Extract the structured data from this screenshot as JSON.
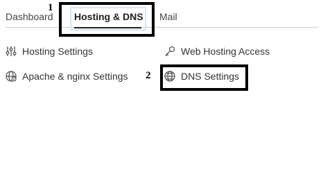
{
  "tabs": {
    "dashboard": "Dashboard",
    "hosting_dns": "Hosting & DNS",
    "mail": "Mail"
  },
  "items": {
    "hosting_settings": "Hosting Settings",
    "web_hosting_access": "Web Hosting Access",
    "apache_nginx_settings": "Apache & nginx Settings",
    "dns_settings": "DNS Settings"
  },
  "annotations": {
    "one": "1",
    "two": "2"
  },
  "icons": {
    "hosting_settings": "sliders-icon",
    "web_hosting_access": "key-icon",
    "apache_nginx_settings": "gear-globe-icon",
    "dns_settings": "globe-icon"
  },
  "colors": {
    "active_tab_underline": "#222222",
    "focus_ring": "#cfe6f7",
    "annotation_border": "#000000"
  }
}
